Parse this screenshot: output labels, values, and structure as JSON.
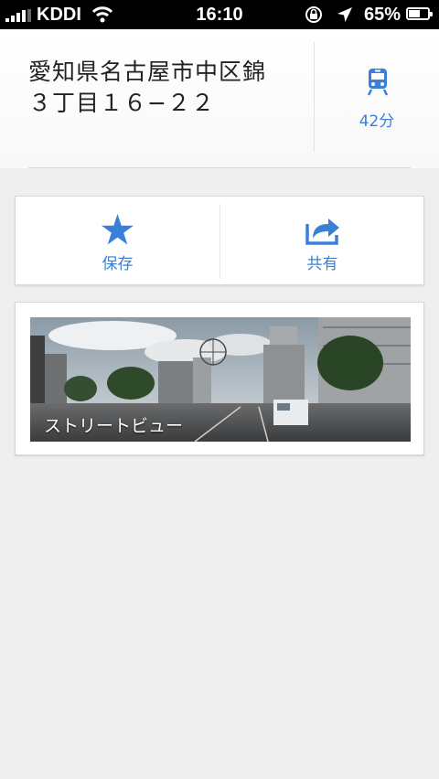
{
  "status_bar": {
    "carrier": "KDDI",
    "time": "16:10",
    "battery_percent": "65%",
    "battery_level": 0.65
  },
  "place": {
    "address_line1": "愛知県名古屋市中区錦",
    "address_line2": "３丁目１６−２２",
    "transit_time": "42分"
  },
  "actions": {
    "save_label": "保存",
    "share_label": "共有"
  },
  "street_view": {
    "label": "ストリートビュー"
  },
  "colors": {
    "accent": "#3a80d9",
    "background": "#efefef"
  }
}
